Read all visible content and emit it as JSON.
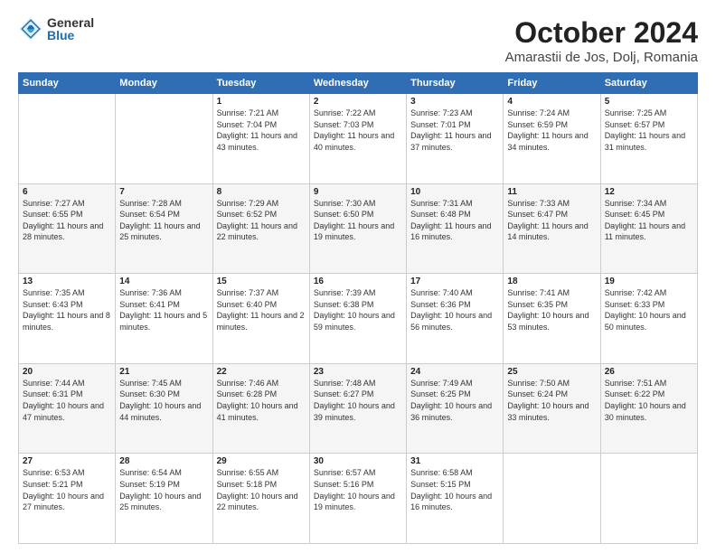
{
  "logo": {
    "general": "General",
    "blue": "Blue"
  },
  "title": "October 2024",
  "subtitle": "Amarastii de Jos, Dolj, Romania",
  "weekdays": [
    "Sunday",
    "Monday",
    "Tuesday",
    "Wednesday",
    "Thursday",
    "Friday",
    "Saturday"
  ],
  "weeks": [
    [
      {
        "day": "",
        "sunrise": "",
        "sunset": "",
        "daylight": ""
      },
      {
        "day": "",
        "sunrise": "",
        "sunset": "",
        "daylight": ""
      },
      {
        "day": "1",
        "sunrise": "Sunrise: 7:21 AM",
        "sunset": "Sunset: 7:04 PM",
        "daylight": "Daylight: 11 hours and 43 minutes."
      },
      {
        "day": "2",
        "sunrise": "Sunrise: 7:22 AM",
        "sunset": "Sunset: 7:03 PM",
        "daylight": "Daylight: 11 hours and 40 minutes."
      },
      {
        "day": "3",
        "sunrise": "Sunrise: 7:23 AM",
        "sunset": "Sunset: 7:01 PM",
        "daylight": "Daylight: 11 hours and 37 minutes."
      },
      {
        "day": "4",
        "sunrise": "Sunrise: 7:24 AM",
        "sunset": "Sunset: 6:59 PM",
        "daylight": "Daylight: 11 hours and 34 minutes."
      },
      {
        "day": "5",
        "sunrise": "Sunrise: 7:25 AM",
        "sunset": "Sunset: 6:57 PM",
        "daylight": "Daylight: 11 hours and 31 minutes."
      }
    ],
    [
      {
        "day": "6",
        "sunrise": "Sunrise: 7:27 AM",
        "sunset": "Sunset: 6:55 PM",
        "daylight": "Daylight: 11 hours and 28 minutes."
      },
      {
        "day": "7",
        "sunrise": "Sunrise: 7:28 AM",
        "sunset": "Sunset: 6:54 PM",
        "daylight": "Daylight: 11 hours and 25 minutes."
      },
      {
        "day": "8",
        "sunrise": "Sunrise: 7:29 AM",
        "sunset": "Sunset: 6:52 PM",
        "daylight": "Daylight: 11 hours and 22 minutes."
      },
      {
        "day": "9",
        "sunrise": "Sunrise: 7:30 AM",
        "sunset": "Sunset: 6:50 PM",
        "daylight": "Daylight: 11 hours and 19 minutes."
      },
      {
        "day": "10",
        "sunrise": "Sunrise: 7:31 AM",
        "sunset": "Sunset: 6:48 PM",
        "daylight": "Daylight: 11 hours and 16 minutes."
      },
      {
        "day": "11",
        "sunrise": "Sunrise: 7:33 AM",
        "sunset": "Sunset: 6:47 PM",
        "daylight": "Daylight: 11 hours and 14 minutes."
      },
      {
        "day": "12",
        "sunrise": "Sunrise: 7:34 AM",
        "sunset": "Sunset: 6:45 PM",
        "daylight": "Daylight: 11 hours and 11 minutes."
      }
    ],
    [
      {
        "day": "13",
        "sunrise": "Sunrise: 7:35 AM",
        "sunset": "Sunset: 6:43 PM",
        "daylight": "Daylight: 11 hours and 8 minutes."
      },
      {
        "day": "14",
        "sunrise": "Sunrise: 7:36 AM",
        "sunset": "Sunset: 6:41 PM",
        "daylight": "Daylight: 11 hours and 5 minutes."
      },
      {
        "day": "15",
        "sunrise": "Sunrise: 7:37 AM",
        "sunset": "Sunset: 6:40 PM",
        "daylight": "Daylight: 11 hours and 2 minutes."
      },
      {
        "day": "16",
        "sunrise": "Sunrise: 7:39 AM",
        "sunset": "Sunset: 6:38 PM",
        "daylight": "Daylight: 10 hours and 59 minutes."
      },
      {
        "day": "17",
        "sunrise": "Sunrise: 7:40 AM",
        "sunset": "Sunset: 6:36 PM",
        "daylight": "Daylight: 10 hours and 56 minutes."
      },
      {
        "day": "18",
        "sunrise": "Sunrise: 7:41 AM",
        "sunset": "Sunset: 6:35 PM",
        "daylight": "Daylight: 10 hours and 53 minutes."
      },
      {
        "day": "19",
        "sunrise": "Sunrise: 7:42 AM",
        "sunset": "Sunset: 6:33 PM",
        "daylight": "Daylight: 10 hours and 50 minutes."
      }
    ],
    [
      {
        "day": "20",
        "sunrise": "Sunrise: 7:44 AM",
        "sunset": "Sunset: 6:31 PM",
        "daylight": "Daylight: 10 hours and 47 minutes."
      },
      {
        "day": "21",
        "sunrise": "Sunrise: 7:45 AM",
        "sunset": "Sunset: 6:30 PM",
        "daylight": "Daylight: 10 hours and 44 minutes."
      },
      {
        "day": "22",
        "sunrise": "Sunrise: 7:46 AM",
        "sunset": "Sunset: 6:28 PM",
        "daylight": "Daylight: 10 hours and 41 minutes."
      },
      {
        "day": "23",
        "sunrise": "Sunrise: 7:48 AM",
        "sunset": "Sunset: 6:27 PM",
        "daylight": "Daylight: 10 hours and 39 minutes."
      },
      {
        "day": "24",
        "sunrise": "Sunrise: 7:49 AM",
        "sunset": "Sunset: 6:25 PM",
        "daylight": "Daylight: 10 hours and 36 minutes."
      },
      {
        "day": "25",
        "sunrise": "Sunrise: 7:50 AM",
        "sunset": "Sunset: 6:24 PM",
        "daylight": "Daylight: 10 hours and 33 minutes."
      },
      {
        "day": "26",
        "sunrise": "Sunrise: 7:51 AM",
        "sunset": "Sunset: 6:22 PM",
        "daylight": "Daylight: 10 hours and 30 minutes."
      }
    ],
    [
      {
        "day": "27",
        "sunrise": "Sunrise: 6:53 AM",
        "sunset": "Sunset: 5:21 PM",
        "daylight": "Daylight: 10 hours and 27 minutes."
      },
      {
        "day": "28",
        "sunrise": "Sunrise: 6:54 AM",
        "sunset": "Sunset: 5:19 PM",
        "daylight": "Daylight: 10 hours and 25 minutes."
      },
      {
        "day": "29",
        "sunrise": "Sunrise: 6:55 AM",
        "sunset": "Sunset: 5:18 PM",
        "daylight": "Daylight: 10 hours and 22 minutes."
      },
      {
        "day": "30",
        "sunrise": "Sunrise: 6:57 AM",
        "sunset": "Sunset: 5:16 PM",
        "daylight": "Daylight: 10 hours and 19 minutes."
      },
      {
        "day": "31",
        "sunrise": "Sunrise: 6:58 AM",
        "sunset": "Sunset: 5:15 PM",
        "daylight": "Daylight: 10 hours and 16 minutes."
      },
      {
        "day": "",
        "sunrise": "",
        "sunset": "",
        "daylight": ""
      },
      {
        "day": "",
        "sunrise": "",
        "sunset": "",
        "daylight": ""
      }
    ]
  ]
}
